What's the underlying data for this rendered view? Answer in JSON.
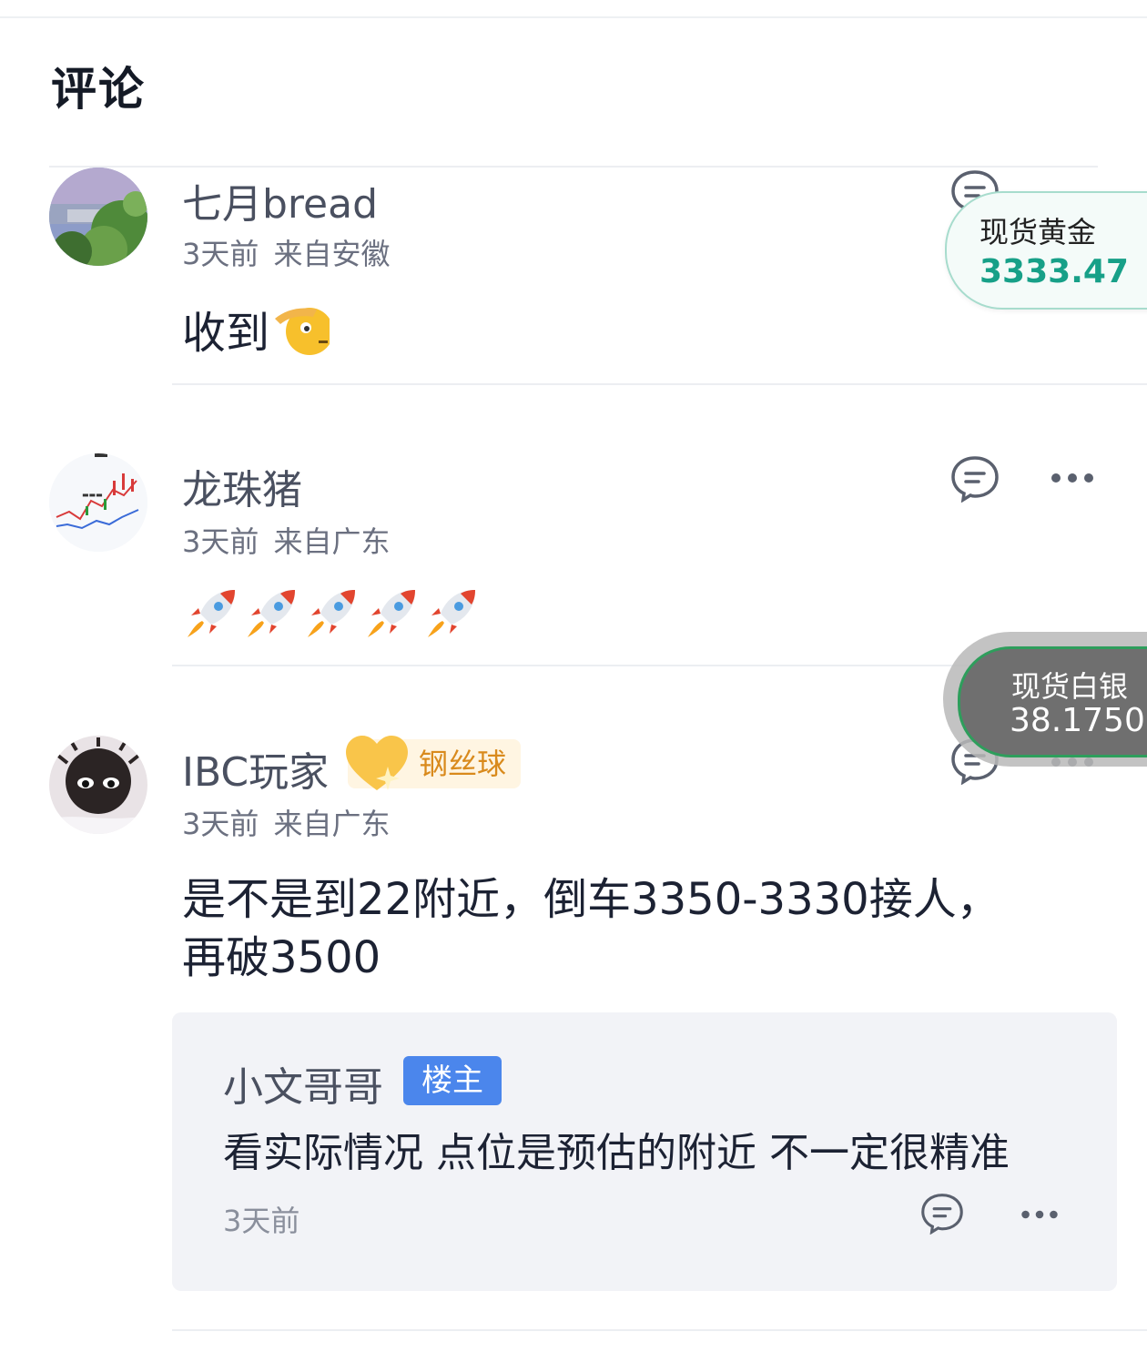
{
  "section_title": "评论",
  "comments": [
    {
      "user": "七月bread",
      "time": "3天前",
      "location": "来自安徽",
      "text": "收到",
      "emoji": [
        "saluting-face"
      ]
    },
    {
      "user": "龙珠猪",
      "time": "3天前",
      "location": "来自广东",
      "text": "",
      "emoji": [
        "rocket",
        "rocket",
        "rocket",
        "rocket",
        "rocket"
      ]
    },
    {
      "user": "IBC玩家",
      "badge": "钢丝球",
      "time": "3天前",
      "location": "来自广东",
      "text_line1": "是不是到22附近，倒车3350-3330接人，",
      "text_line2": "再破3500",
      "reply": {
        "user": "小文哥哥",
        "tag": "楼主",
        "text": "看实际情况 点位是预估的附近 不一定很精准",
        "time": "3天前"
      }
    }
  ],
  "floating_tickers": [
    {
      "label": "现货黄金",
      "value": "3333.47",
      "color": "#17a088"
    },
    {
      "label": "现货白银",
      "value": "38.1750",
      "color": "#ffffff"
    }
  ],
  "colors": {
    "accent_blue": "#4b86ec",
    "badge_orange": "#d98a1c",
    "gold_green": "#17a088"
  }
}
